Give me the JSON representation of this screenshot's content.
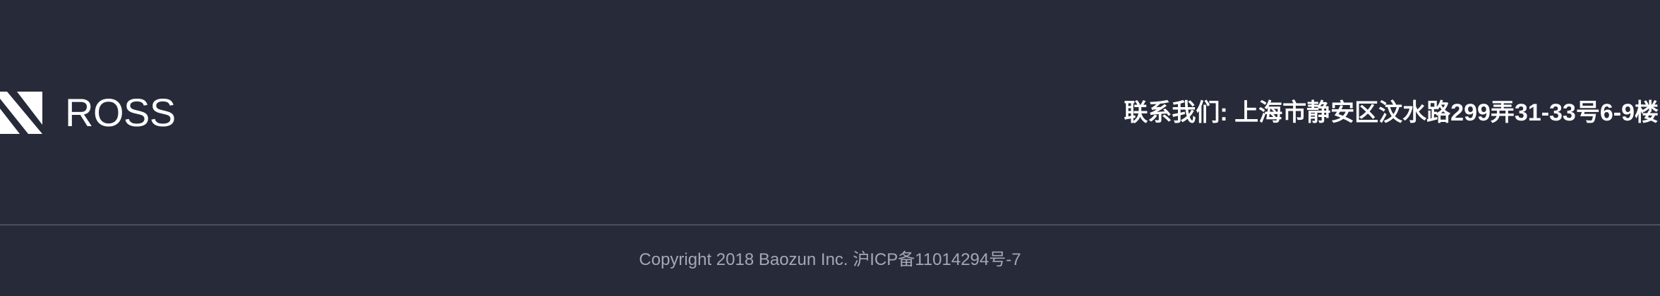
{
  "brand": {
    "logo_icon": "diagonal-slash-logo-icon",
    "name": "ROSS"
  },
  "contact": {
    "text": "联系我们: 上海市静安区汶水路299弄31-33号6-9楼"
  },
  "footer": {
    "copyright": "Copyright 2018 Baozun Inc. 沪ICP备11014294号-7"
  },
  "colors": {
    "background": "#272a39",
    "text": "#ffffff",
    "divider": "#4b4f5e",
    "muted_text": "#a5a8b2"
  }
}
